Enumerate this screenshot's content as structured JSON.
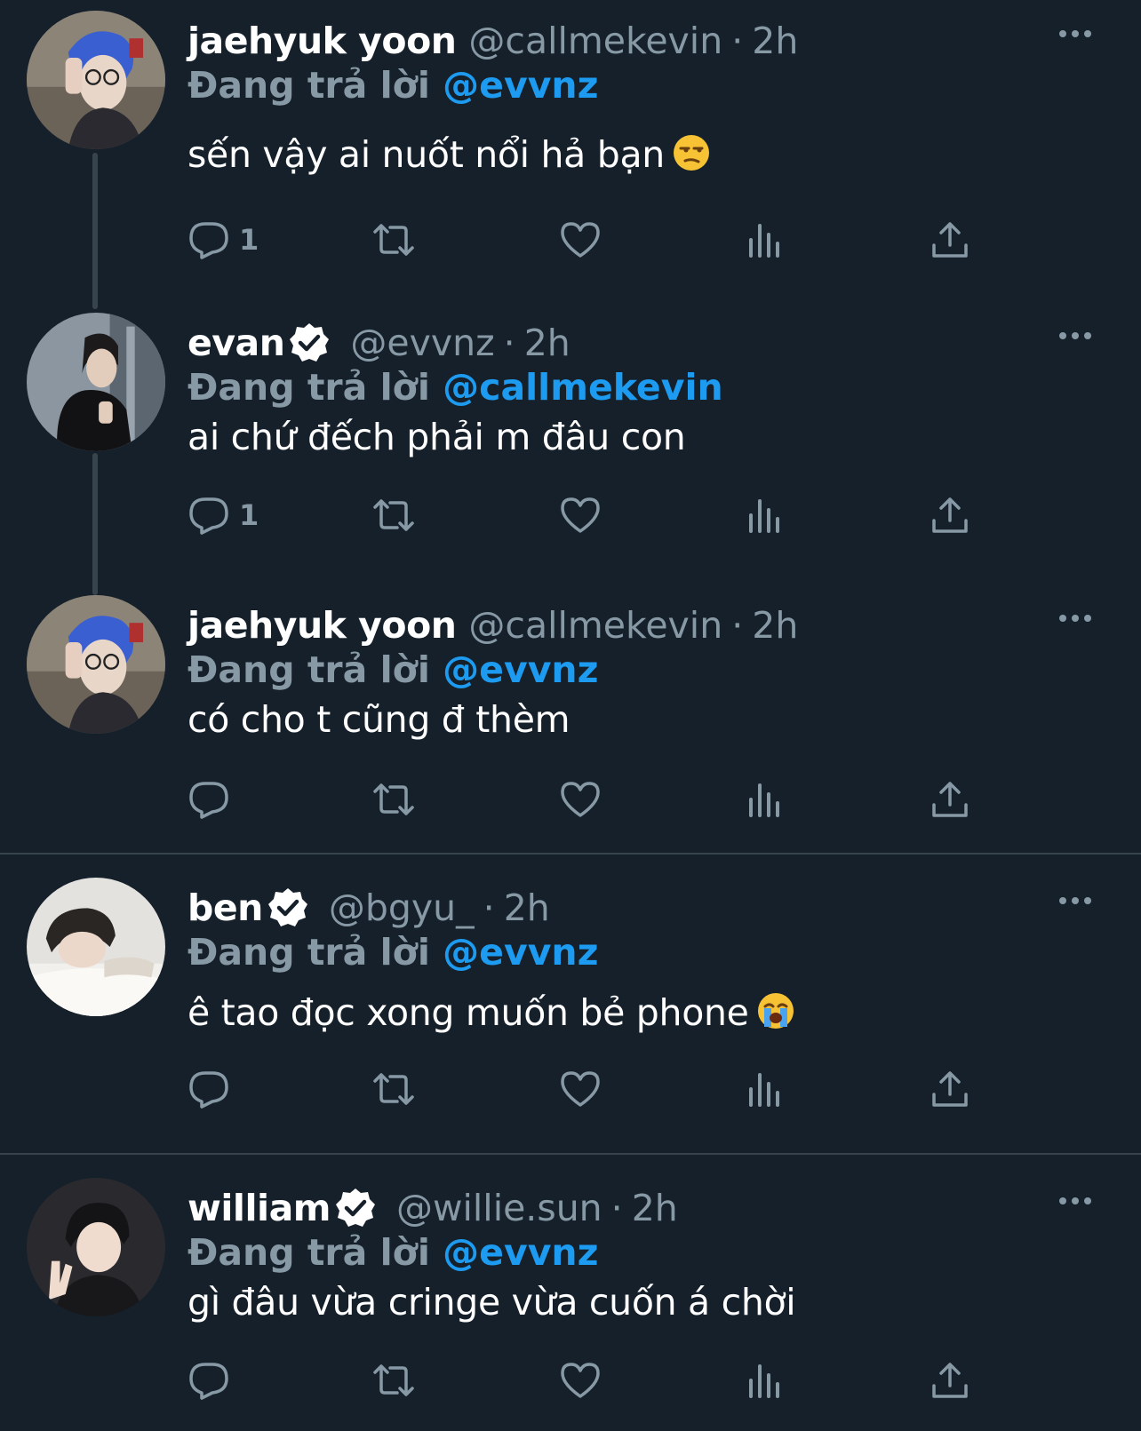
{
  "reply_prefix": "Đang trả lời",
  "tweets": [
    {
      "name": "jaehyuk yoon",
      "verified": false,
      "handle": "@callmekevin",
      "separator": "·",
      "time": "2h",
      "replying_to": "@evvnz",
      "text": "sến vậy ai nuốt nổi hả bạn",
      "emoji": "unamused-face-icon",
      "reply_count": "1"
    },
    {
      "name": "evan",
      "verified": true,
      "handle": "@evvnz",
      "separator": "·",
      "time": "2h",
      "replying_to": "@callmekevin",
      "text": "ai chứ đếch phải m đâu con",
      "reply_count": "1"
    },
    {
      "name": "jaehyuk yoon",
      "verified": false,
      "handle": "@callmekevin",
      "separator": "·",
      "time": "2h",
      "replying_to": "@evvnz",
      "text": "có cho t cũng đ thèm",
      "reply_count": ""
    },
    {
      "name": "ben",
      "verified": true,
      "handle": "@bgyu_",
      "separator": "·",
      "time": "2h",
      "replying_to": "@evvnz",
      "text": " ê tao đọc xong muốn bẻ phone",
      "emoji": "loudly-crying-face-icon",
      "reply_count": ""
    },
    {
      "name": "william",
      "verified": true,
      "handle": "@willie.sun",
      "separator": "·",
      "time": "2h",
      "replying_to": "@evvnz",
      "text": "gì đâu vừa cringe vừa cuốn á chời",
      "reply_count": ""
    }
  ],
  "colors": {
    "background": "#15202b",
    "secondary_text": "#8899a6",
    "mention": "#1d9bf0",
    "thread_line": "#38444d",
    "verified_badge": "#ffffff"
  },
  "icons": {
    "more": "more-horizontal-icon",
    "reply": "reply-bubble-icon",
    "retweet": "retweet-icon",
    "like": "heart-icon",
    "views": "views-chart-icon",
    "share": "share-upload-icon",
    "verified": "verified-badge-icon"
  }
}
